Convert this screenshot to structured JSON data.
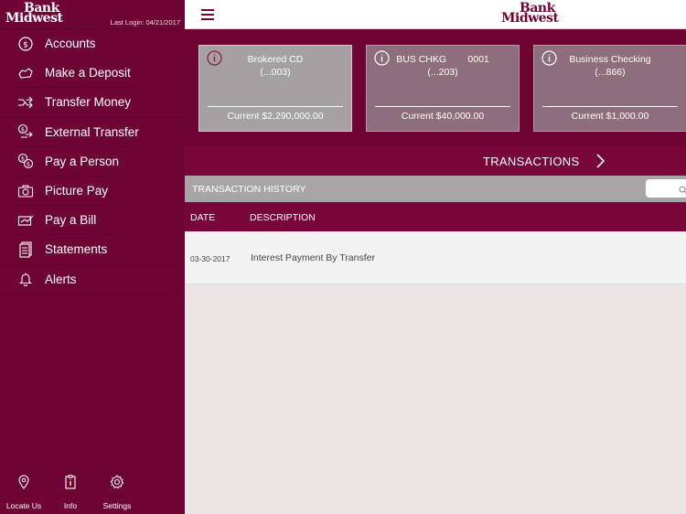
{
  "sidebar": {
    "logo_line1": "Bank",
    "logo_line2": "Midwest",
    "last_login": "Last Login: 04/21/2017",
    "items": [
      {
        "label": "Accounts",
        "icon": "dollar-circle-icon"
      },
      {
        "label": "Make a Deposit",
        "icon": "deposit-icon"
      },
      {
        "label": "Transfer Money",
        "icon": "transfer-icon"
      },
      {
        "label": "External Transfer",
        "icon": "external-transfer-icon"
      },
      {
        "label": "Pay a Person",
        "icon": "pay-person-icon"
      },
      {
        "label": "Picture Pay",
        "icon": "camera-icon"
      },
      {
        "label": "Pay a Bill",
        "icon": "bill-icon"
      },
      {
        "label": "Statements",
        "icon": "document-icon"
      },
      {
        "label": "Alerts",
        "icon": "bell-icon"
      }
    ],
    "footer": [
      {
        "label": "Locate Us",
        "icon": "location-pin-icon"
      },
      {
        "label": "Info",
        "icon": "info-clipboard-icon"
      },
      {
        "label": "Settings",
        "icon": "gear-icon"
      }
    ]
  },
  "topbar": {
    "logo_line1": "Bank",
    "logo_line2": "Midwest"
  },
  "accounts": [
    {
      "name": "Brokered CD",
      "number": "(...003)",
      "balance": "Current $2,290,000.00",
      "selected": true
    },
    {
      "name": "BUS CHKG        0001",
      "number": "(...203)",
      "balance": "Current $40,000.00",
      "selected": false
    },
    {
      "name": "Business Checking",
      "number": "(...866)",
      "balance": "Current $1,000.00",
      "selected": false
    }
  ],
  "transactions": {
    "title": "TRANSACTIONS",
    "history_label": "TRANSACTION HISTORY",
    "columns": {
      "date": "DATE",
      "description": "DESCRIPTION"
    },
    "rows": [
      {
        "date": "03-30-2017",
        "description": "Interest Payment By Transfer"
      }
    ]
  },
  "colors": {
    "brand": "#6e0433",
    "brand_bar": "#790638",
    "background": "#ebe3e4"
  }
}
